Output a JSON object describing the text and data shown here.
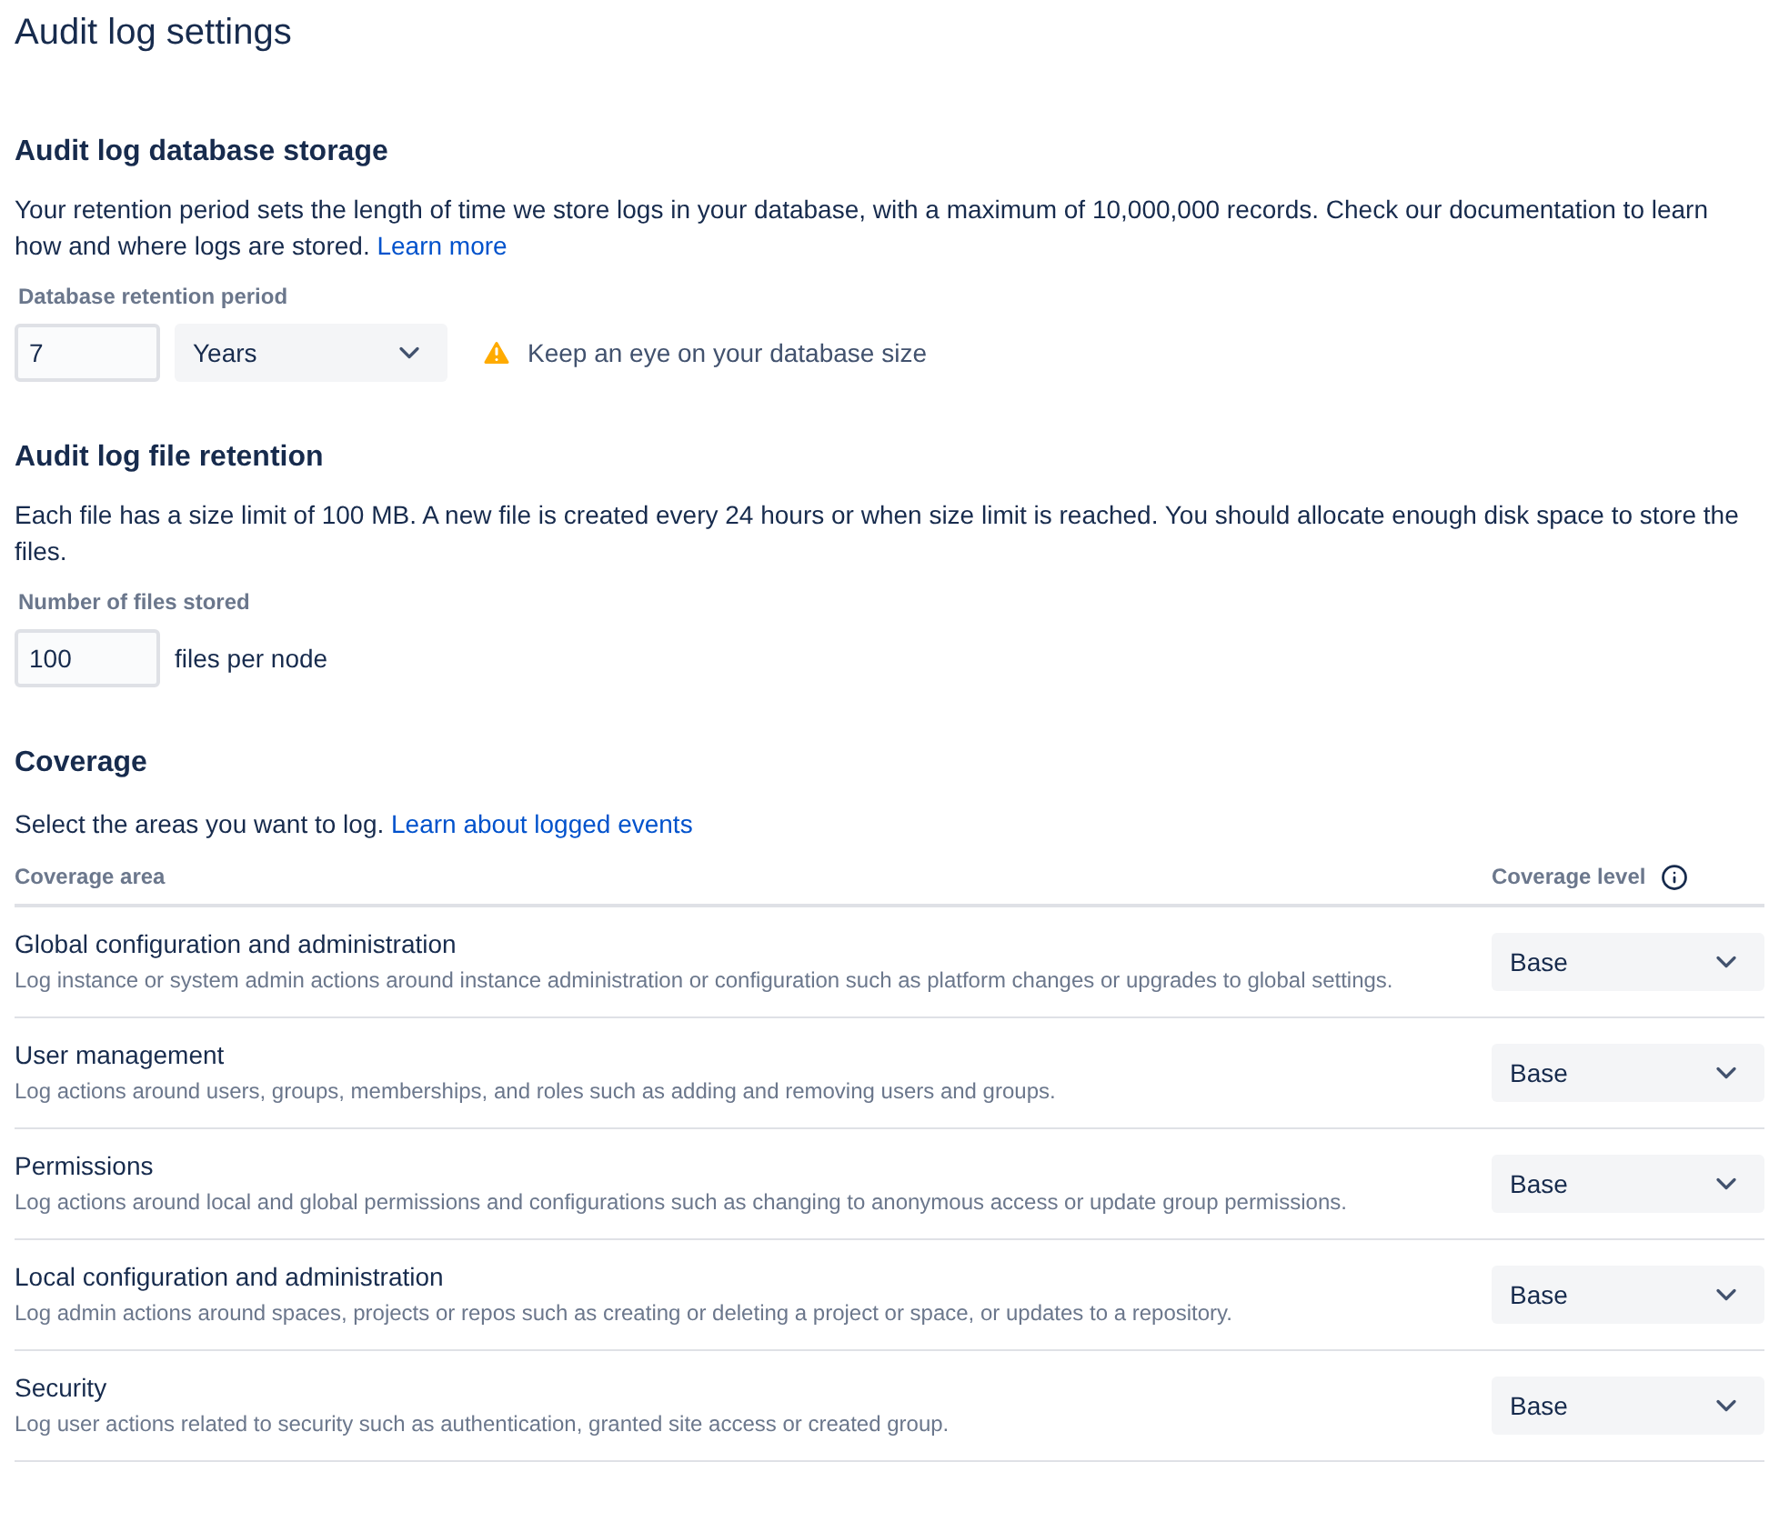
{
  "title": "Audit log settings",
  "database_storage": {
    "heading": "Audit log database storage",
    "description": "Your retention period sets the length of time we store logs in your database, with a maximum of 10,000,000 records. Check our documentation to learn how and where logs are stored.",
    "link": "Learn more",
    "field_label": "Database retention period",
    "value": "7",
    "unit": "Years",
    "warning": "Keep an eye on your database size"
  },
  "file_retention": {
    "heading": "Audit log file retention",
    "description": "Each file has a size limit of 100 MB. A new file is created every 24 hours or when size limit is reached. You should allocate enough disk space to store the files.",
    "field_label": "Number of files stored",
    "value": "100",
    "suffix": "files per node"
  },
  "coverage": {
    "heading": "Coverage",
    "description": "Select the areas you want to log.",
    "link": "Learn about logged events",
    "columns": [
      "Coverage area",
      "Coverage level"
    ],
    "rows": [
      {
        "name": "Global configuration and administration",
        "description": "Log instance or system admin actions around instance administration or configuration such as platform changes or upgrades to global settings.",
        "level": "Base"
      },
      {
        "name": "User management",
        "description": "Log actions around users, groups, memberships, and roles such as adding and removing users and groups.",
        "level": "Base"
      },
      {
        "name": "Permissions",
        "description": "Log actions around local and global permissions and configurations such as changing to anonymous access or update group permissions.",
        "level": "Base"
      },
      {
        "name": "Local configuration and administration",
        "description": "Log admin actions around spaces, projects or repos such as creating or deleting a project or space, or updates to a repository.",
        "level": "Base"
      },
      {
        "name": "Security",
        "description": "Log user actions related to security such as authentication, granted site access or created group.",
        "level": "Base"
      }
    ]
  }
}
